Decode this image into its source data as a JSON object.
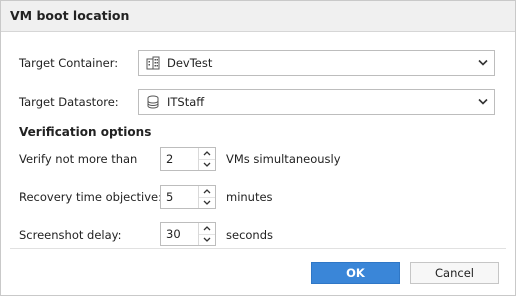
{
  "dialog": {
    "title": "VM boot location"
  },
  "container": {
    "label": "Target Container:",
    "value": "DevTest",
    "icon": "building-icon"
  },
  "datastore": {
    "label": "Target Datastore:",
    "value": "ITStaff",
    "icon": "database-icon"
  },
  "verification": {
    "heading": "Verification options",
    "vms": {
      "label": "Verify not more than",
      "value": "2",
      "suffix": "VMs simultaneously"
    },
    "rto": {
      "label": "Recovery time objective:",
      "value": "5",
      "suffix": "minutes"
    },
    "screenshot": {
      "label": "Screenshot delay:",
      "value": "30",
      "suffix": "seconds"
    }
  },
  "buttons": {
    "ok": "OK",
    "cancel": "Cancel"
  },
  "colors": {
    "accent": "#3a86d8",
    "title_bar": "#f0f0f0"
  }
}
